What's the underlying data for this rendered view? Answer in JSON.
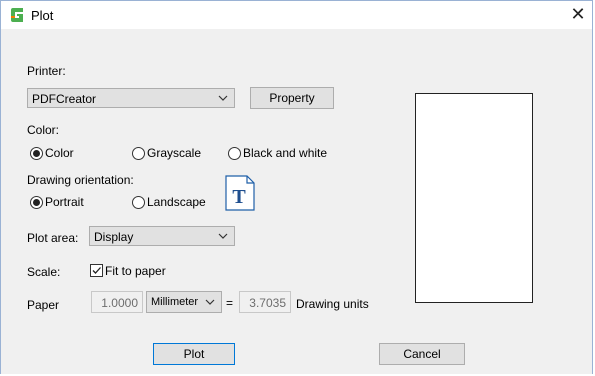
{
  "window": {
    "title": "Plot",
    "close_glyph": "✕"
  },
  "printer": {
    "label": "Printer:",
    "selected": "PDFCreator",
    "property_button": "Property"
  },
  "color": {
    "label": "Color:",
    "options": [
      "Color",
      "Grayscale",
      "Black and white"
    ],
    "selected": "Color"
  },
  "orientation": {
    "label": "Drawing orientation:",
    "options": [
      "Portrait",
      "Landscape"
    ],
    "selected": "Portrait",
    "icon_letter": "T"
  },
  "plot_area": {
    "label": "Plot area:",
    "selected": "Display"
  },
  "scale": {
    "label": "Scale:",
    "fit_to_paper_label": "Fit to paper",
    "fit_to_paper_checked": true
  },
  "paper": {
    "label": "Paper",
    "paper_value": "1.0000",
    "unit_selected": "Millimeter",
    "equals": "=",
    "drawing_value": "3.7035",
    "drawing_units_label": "Drawing units"
  },
  "buttons": {
    "plot": "Plot",
    "cancel": "Cancel"
  },
  "colors": {
    "accent": "#0078d7",
    "app_icon_green": "#4caf50",
    "app_icon_orange": "#f57c00"
  }
}
